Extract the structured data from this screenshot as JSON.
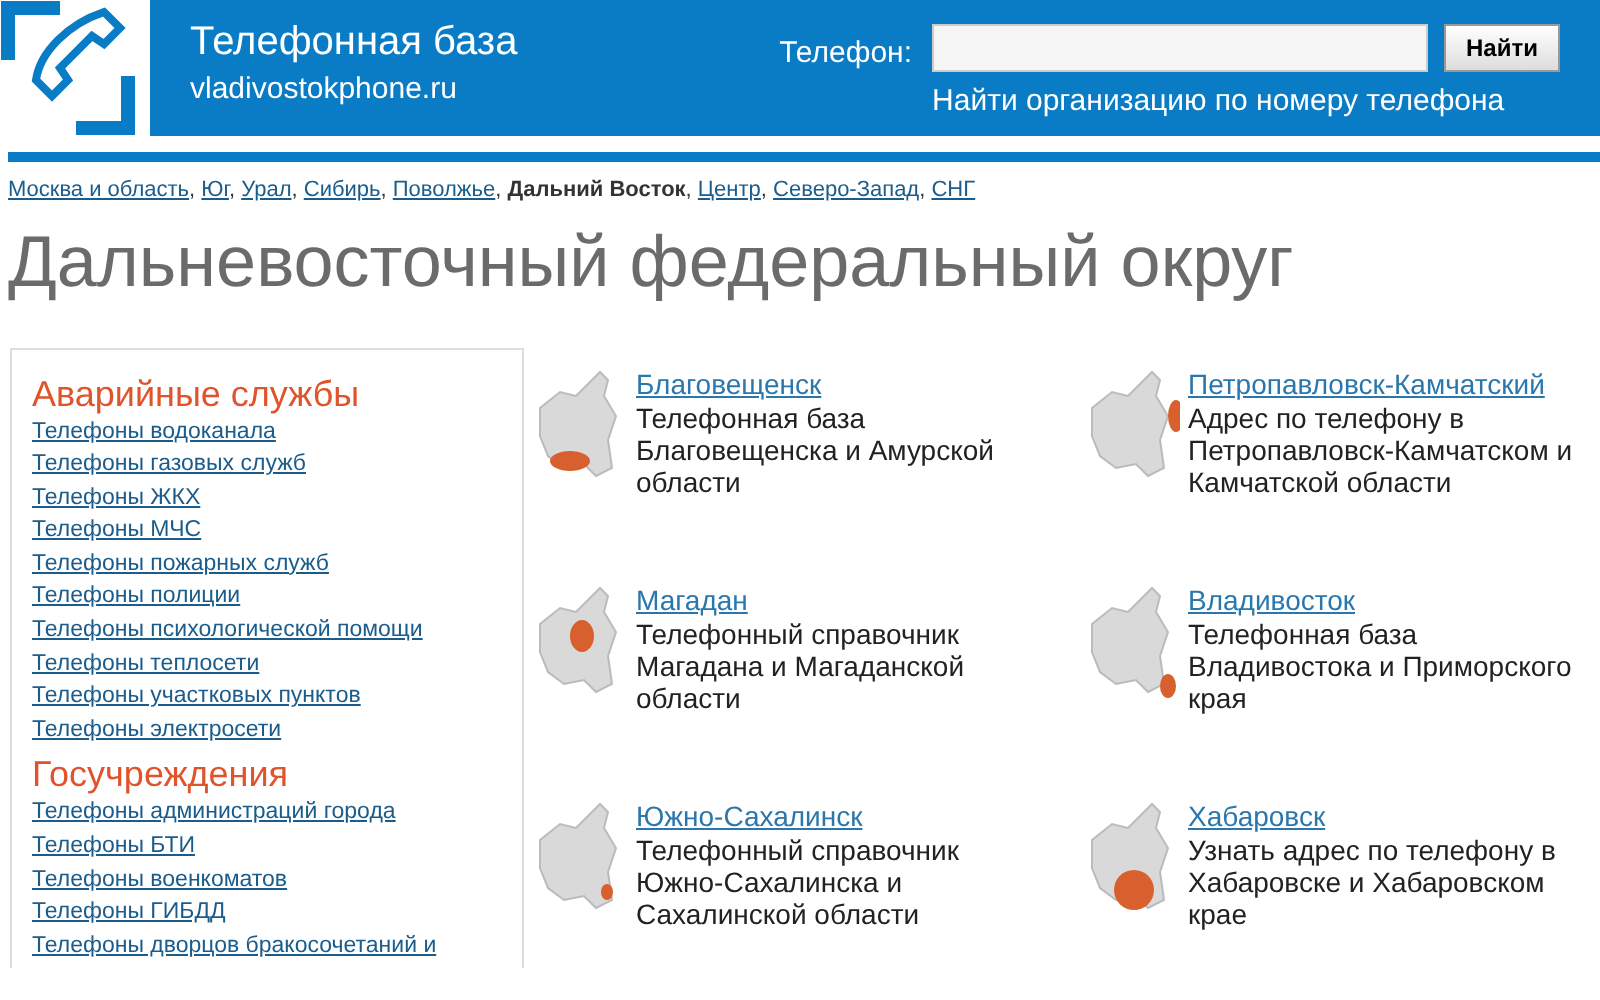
{
  "header": {
    "title": "Телефонная база",
    "domain": "vladivostokphone.ru",
    "phone_label": "Телефон:",
    "search_button": "Найти",
    "search_hint": "Найти организацию по номеру телефона"
  },
  "region_separator": ",",
  "regions": [
    {
      "label": "Москва и область",
      "selected": false
    },
    {
      "label": "Юг",
      "selected": false
    },
    {
      "label": "Урал",
      "selected": false
    },
    {
      "label": "Сибирь",
      "selected": false
    },
    {
      "label": "Поволжье",
      "selected": false
    },
    {
      "label": "Дальний Восток",
      "selected": true
    },
    {
      "label": "Центр",
      "selected": false
    },
    {
      "label": "Северо-Запад",
      "selected": false
    },
    {
      "label": "СНГ",
      "selected": false
    }
  ],
  "page_title": "Дальневосточный федеральный округ",
  "sidebar": [
    {
      "heading": "Аварийные службы",
      "items": [
        "Телефоны водоканала",
        "Телефоны газовых служб",
        "Телефоны ЖКХ",
        "Телефоны МЧС",
        "Телефоны пожарных служб",
        "Телефоны полиции",
        "Телефоны психологической помощи",
        "Телефоны теплосети",
        "Телефоны участковых пунктов",
        "Телефоны электросети"
      ]
    },
    {
      "heading": "Госучреждения",
      "items": [
        "Телефоны администраций города",
        "Телефоны БТИ",
        "Телефоны военкоматов",
        "Телефоны ГИБДД",
        "Телефоны дворцов бракосочетаний и"
      ]
    }
  ],
  "cities": [
    {
      "name": "Благовещенск",
      "description": "Телефонная база Благовещенска и Амурской области"
    },
    {
      "name": "Петропавловск-Камчатский",
      "description": "Адрес по телефону в Петропавловск-Камчатском и Камчатской области"
    },
    {
      "name": "Магадан",
      "description": "Телефонный справочник Магадана и Магаданской области"
    },
    {
      "name": "Владивосток",
      "description": "Телефонная база Владивостока и Приморского края"
    },
    {
      "name": "Южно-Сахалинск",
      "description": "Телефонный справочник Южно-Сахалинска и Сахалинской области"
    },
    {
      "name": "Хабаровск",
      "description": "Узнать адрес по телефону в Хабаровске и Хабаровском крае"
    }
  ]
}
